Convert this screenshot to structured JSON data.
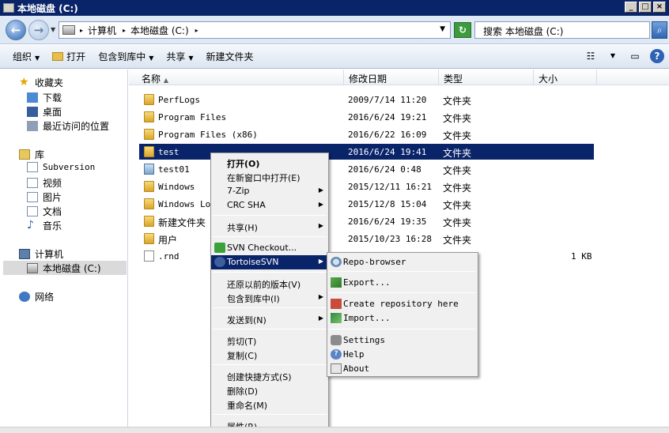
{
  "window": {
    "title": "本地磁盘 (C:)",
    "min": "_",
    "max": "□",
    "close": "×"
  },
  "address": {
    "crumbs": [
      "计算机",
      "本地磁盘 (C:)"
    ],
    "search_placeholder": "搜索 本地磁盘 (C:)"
  },
  "toolbar": {
    "organize": "组织",
    "open": "打开",
    "include_library": "包含到库中",
    "share": "共享",
    "new_folder": "新建文件夹"
  },
  "sidebar": {
    "favorites": "收藏夹",
    "downloads": "下载",
    "desktop": "桌面",
    "recent": "最近访问的位置",
    "libraries": "库",
    "subversion": "Subversion",
    "videos": "视频",
    "pictures": "图片",
    "documents": "文档",
    "music": "音乐",
    "computer": "计算机",
    "local_disk": "本地磁盘 (C:)",
    "network": "网络"
  },
  "columns": {
    "name": "名称",
    "date": "修改日期",
    "type": "类型",
    "size": "大小"
  },
  "files": [
    {
      "name": "PerfLogs",
      "date": "2009/7/14 11:20",
      "type": "文件夹",
      "size": ""
    },
    {
      "name": "Program Files",
      "date": "2016/6/24 19:21",
      "type": "文件夹",
      "size": ""
    },
    {
      "name": "Program Files (x86)",
      "date": "2016/6/22 16:09",
      "type": "文件夹",
      "size": ""
    },
    {
      "name": "test",
      "date": "2016/6/24 19:41",
      "type": "文件夹",
      "size": ""
    },
    {
      "name": "test01",
      "date": "2016/6/24 0:48",
      "type": "文件夹",
      "size": ""
    },
    {
      "name": "Windows",
      "date": "2015/12/11 16:21",
      "type": "文件夹",
      "size": ""
    },
    {
      "name": "Windows Loa",
      "date": "2015/12/8 15:04",
      "type": "文件夹",
      "size": ""
    },
    {
      "name": "新建文件夹",
      "date": "2016/6/24 19:35",
      "type": "文件夹",
      "size": ""
    },
    {
      "name": "用户",
      "date": "2015/10/23 16:28",
      "type": "文件夹",
      "size": ""
    },
    {
      "name": ".rnd",
      "date": "",
      "type": "",
      "size": "1 KB"
    }
  ],
  "context_menu": {
    "open": "打开(O)",
    "open_new_window": "在新窗口中打开(E)",
    "seven_zip": "7-Zip",
    "crc_sha": "CRC SHA",
    "share": "共享(H)",
    "svn_checkout": "SVN Checkout...",
    "tortoise_svn": "TortoiseSVN",
    "restore": "还原以前的版本(V)",
    "include_library": "包含到库中(I)",
    "send_to": "发送到(N)",
    "cut": "剪切(T)",
    "copy": "复制(C)",
    "create_shortcut": "创建快捷方式(S)",
    "delete": "删除(D)",
    "rename": "重命名(M)",
    "properties": "属性(R)"
  },
  "svn_submenu": {
    "repo_browser": "Repo-browser",
    "export": "Export...",
    "create_repo": "Create repository here",
    "import": "Import...",
    "settings": "Settings",
    "help": "Help",
    "about": "About"
  }
}
